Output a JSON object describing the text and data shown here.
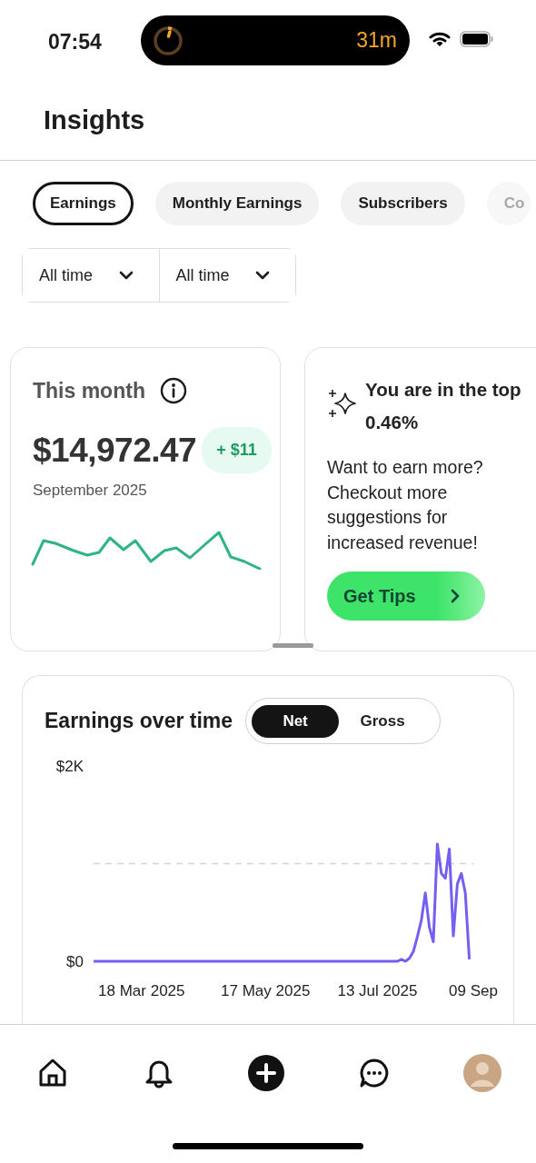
{
  "status_bar": {
    "time": "07:54",
    "timer": "31m"
  },
  "header": {
    "title": "Insights"
  },
  "filters": [
    {
      "label": "Earnings",
      "selected": true
    },
    {
      "label": "Monthly Earnings",
      "selected": false
    },
    {
      "label": "Subscribers",
      "selected": false
    },
    {
      "label": "Co",
      "selected": false
    }
  ],
  "dropdowns": [
    {
      "value": "All time"
    },
    {
      "value": "All time"
    }
  ],
  "summary_card": {
    "title": "This month",
    "amount": "$14,972.47",
    "change": "+ $11",
    "period": "September 2025"
  },
  "tips_card": {
    "headline": "You are in the top 0.46%",
    "body": "Want to earn more? Checkout more suggestions for increased revenue!",
    "button": "Get Tips"
  },
  "earnings_chart": {
    "title": "Earnings over time",
    "modes": [
      {
        "label": "Net",
        "selected": true
      },
      {
        "label": "Gross",
        "selected": false
      }
    ],
    "chart_data": {
      "type": "line",
      "categories": [
        null,
        null,
        null,
        null,
        null,
        null,
        null,
        null,
        null,
        null,
        null,
        null,
        "18 Mar 2025",
        null,
        null,
        null,
        null,
        null,
        null,
        null,
        null,
        null,
        null,
        null,
        null,
        null,
        null,
        null,
        null,
        null,
        null,
        null,
        null,
        null,
        null,
        null,
        null,
        null,
        null,
        null,
        null,
        null,
        null,
        "17 May 2025",
        null,
        null,
        null,
        null,
        null,
        null,
        null,
        null,
        null,
        null,
        null,
        null,
        null,
        null,
        null,
        null,
        null,
        null,
        null,
        null,
        null,
        null,
        null,
        null,
        null,
        null,
        null,
        "13 Jul 2025",
        null,
        null,
        null,
        null,
        null,
        null,
        null,
        null,
        null,
        null,
        null,
        null,
        null,
        null,
        null,
        null,
        null,
        null,
        null,
        null,
        null,
        null,
        null,
        "09 Sep"
      ],
      "series": [
        {
          "color": "#7360f2",
          "values": [
            0,
            0,
            0,
            0,
            0,
            0,
            0,
            0,
            0,
            0,
            0,
            0,
            0,
            0,
            0,
            0,
            0,
            0,
            0,
            0,
            0,
            0,
            0,
            0,
            0,
            0,
            0,
            0,
            0,
            0,
            0,
            0,
            0,
            0,
            0,
            0,
            0,
            0,
            0,
            0,
            0,
            0,
            0,
            0,
            0,
            0,
            0,
            0,
            0,
            0,
            0,
            0,
            0,
            0,
            0,
            0,
            0,
            0,
            0,
            0,
            0,
            0,
            0,
            0,
            0,
            0,
            0,
            0,
            0,
            0,
            0,
            0,
            0,
            0,
            0,
            0,
            0,
            20,
            0,
            30,
            100,
            250,
            420,
            700,
            350,
            200,
            1200,
            900,
            850,
            1150,
            260,
            790,
            900,
            700,
            20,
            null
          ]
        }
      ],
      "ylim": [
        0,
        2000
      ],
      "ref_lines": [
        {
          "axis": "y",
          "value": 1000
        }
      ],
      "yticks": [
        {
          "value": 0,
          "label": "$0"
        },
        {
          "value": 2000,
          "label": "$2K"
        }
      ]
    }
  },
  "bottom_nav": [
    {
      "kind": "home"
    },
    {
      "kind": "notifications"
    },
    {
      "kind": "create"
    },
    {
      "kind": "messages"
    },
    {
      "kind": "profile"
    }
  ]
}
